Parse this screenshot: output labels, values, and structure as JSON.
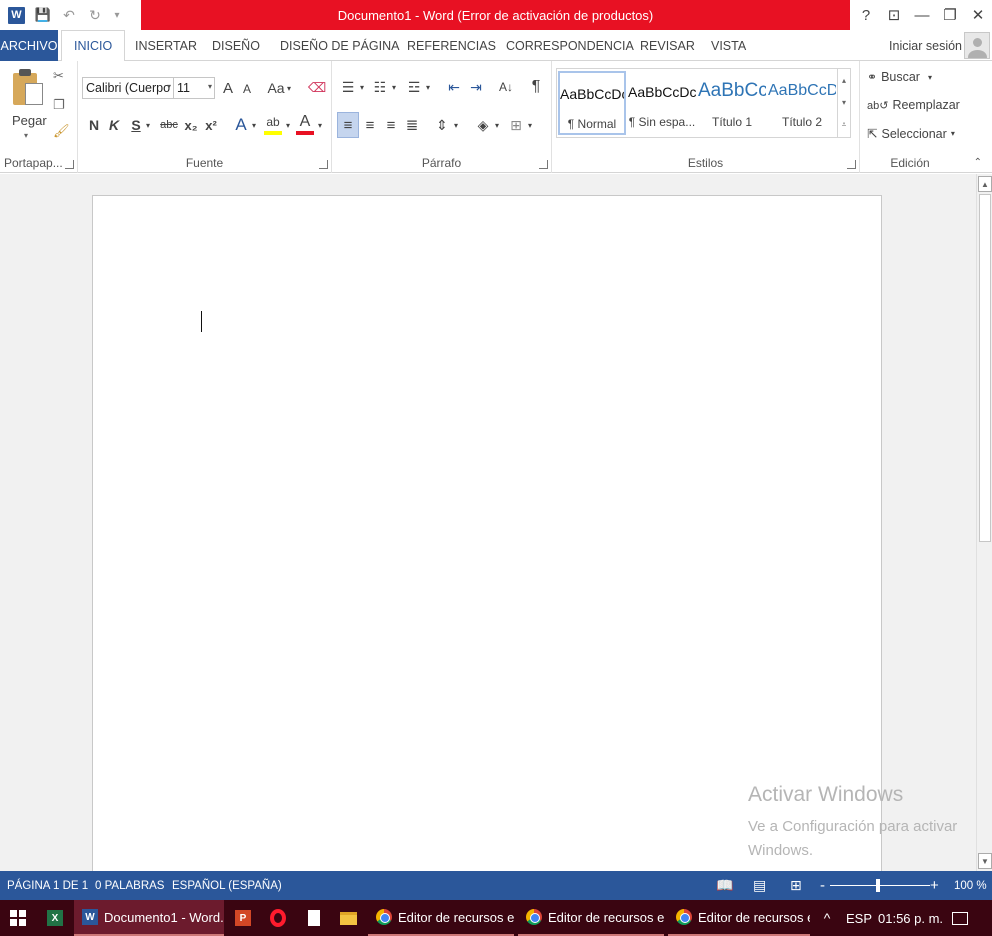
{
  "window": {
    "title": "Documento1 -  Word (Error de activación de productos)",
    "controls": [
      "?",
      "⊡",
      "—",
      "❐",
      "✕"
    ]
  },
  "qat": {
    "app_icon": "W",
    "save": "💾",
    "undo": "↶",
    "redo": "↻",
    "customize": "▾"
  },
  "tabs": {
    "file": "ARCHIVO",
    "items": [
      "INICIO",
      "INSERTAR",
      "DISEÑO",
      "DISEÑO DE PÁGINA",
      "REFERENCIAS",
      "CORRESPONDENCIA",
      "REVISAR",
      "VISTA"
    ],
    "signin": "Iniciar sesión"
  },
  "ribbon": {
    "clipboard": {
      "paste": "Pegar",
      "label": "Portapap..."
    },
    "font": {
      "font_name": "Calibri (Cuerpo",
      "font_size": "11",
      "grow": "A",
      "shrink": "A",
      "case": "Aa",
      "bold": "N",
      "italic": "K",
      "underline": "S",
      "strike": "abc",
      "sub": "x₂",
      "sup": "x²",
      "label": "Fuente"
    },
    "paragraph": {
      "sort": "A↓",
      "pilcrow": "¶",
      "label": "Párrafo"
    },
    "styles": {
      "items": [
        {
          "sample": "AaBbCcDc",
          "name": "¶ Normal"
        },
        {
          "sample": "AaBbCcDc",
          "name": "¶ Sin espa..."
        },
        {
          "sample": "AaBbCc",
          "name": "Título 1"
        },
        {
          "sample": "AaBbCcD",
          "name": "Título 2"
        }
      ],
      "label": "Estilos"
    },
    "editing": {
      "find": "Buscar",
      "replace": "Reemplazar",
      "select": "Seleccionar",
      "label": "Edición"
    }
  },
  "watermark": {
    "line1": "Activar Windows",
    "line2": "Ve a Configuración para activar Windows."
  },
  "status": {
    "page": "PÁGINA 1 DE 1",
    "words": "0 PALABRAS",
    "language": "ESPAÑOL (ESPAÑA)",
    "zoom_minus": "-",
    "zoom_plus": "+",
    "zoom": "100 %"
  },
  "taskbar": {
    "word_item": "Documento1 - Word...",
    "chrome_items": [
      "Editor de recursos e...",
      "Editor de recursos e...",
      "Editor de recursos e..."
    ],
    "tray_arrow": "^",
    "language": "ESP",
    "time": "01:56 p. m."
  }
}
